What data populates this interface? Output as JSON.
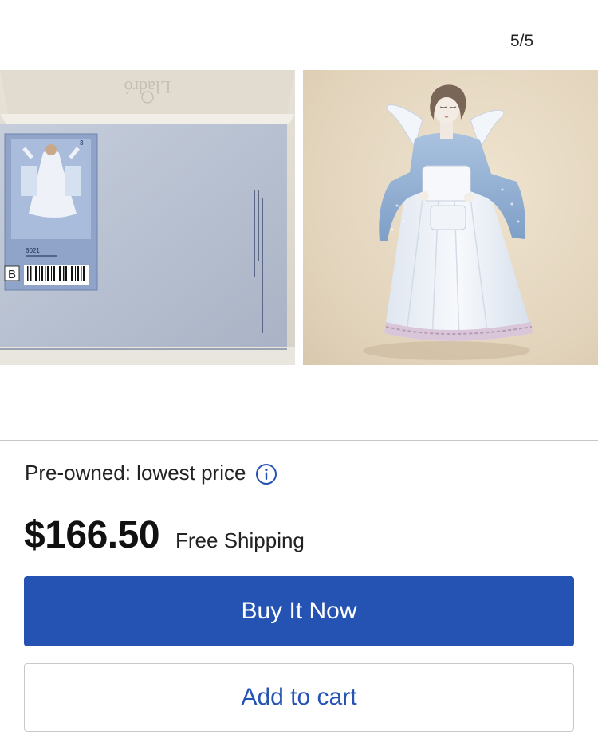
{
  "gallery": {
    "counter": "5/5",
    "images": [
      {
        "label": "box-photo",
        "box_label": "Lladró",
        "item_number": "6021",
        "size_letter": "B"
      },
      {
        "label": "angel-figurine-photo"
      }
    ]
  },
  "listing": {
    "condition_label": "Pre-owned: lowest price",
    "price": "$166.50",
    "shipping": "Free Shipping"
  },
  "actions": {
    "buy_now_label": "Buy It Now",
    "add_to_cart_label": "Add to cart"
  },
  "colors": {
    "primary": "#2553b4",
    "divider": "#c7c7c7",
    "text": "#111820"
  },
  "icons": {
    "info": "info-icon"
  }
}
